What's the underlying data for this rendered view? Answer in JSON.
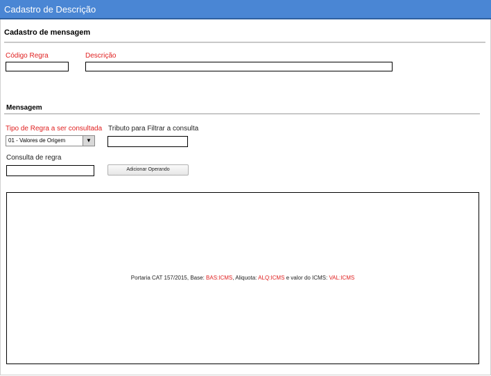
{
  "window": {
    "title": "Cadastro de Descrição"
  },
  "sections": {
    "mensagem_header": "Cadastro de mensagem",
    "mensagem_sub": "Mensagem"
  },
  "fields": {
    "codigo_regra": {
      "label": "Código Regra",
      "value": ""
    },
    "descricao": {
      "label": "Descrição",
      "value": ""
    },
    "tipo_regra": {
      "label": "Tipo de Regra a ser consultada",
      "selected": "01 - Valores de Origem"
    },
    "tributo": {
      "label": "Tributo para Filtrar a consulta",
      "value": ""
    },
    "consulta_regra": {
      "label": "Consulta de regra",
      "value": ""
    }
  },
  "buttons": {
    "adicionar": "Adicionar Operando"
  },
  "message": {
    "text1": "Portaria CAT 157/2015, Base: ",
    "token1": "BAS:ICMS",
    "text2": ", Aliquota: ",
    "token2": "ALQ:ICMS",
    "text3": " e valor do ICMS: ",
    "token3": "VAL:ICMS"
  },
  "colors": {
    "titlebar": "#4a86d4",
    "required": "#e02020",
    "token": "#e02020"
  },
  "icons": {
    "dropdown": "triangle-down-icon"
  }
}
